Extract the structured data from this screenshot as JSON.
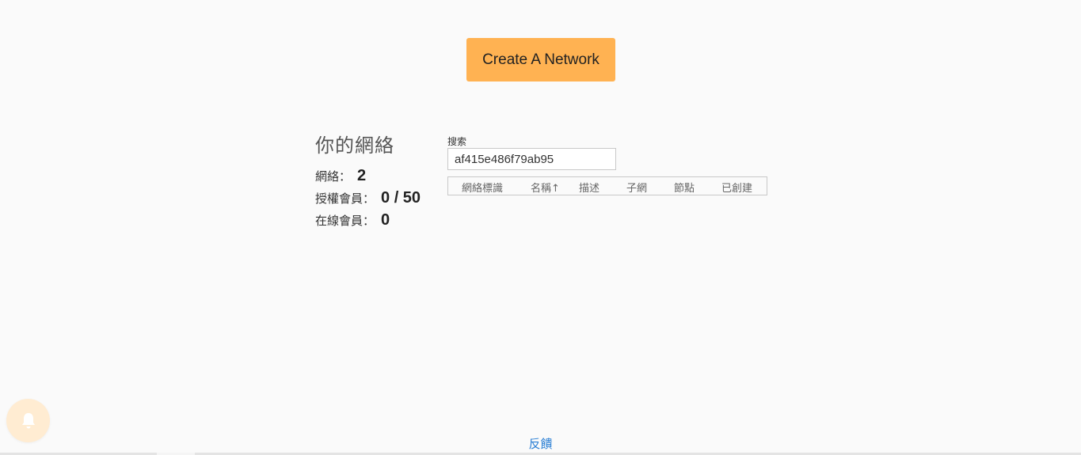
{
  "actions": {
    "create_network_label": "Create A Network"
  },
  "stats": {
    "title": "你的網絡",
    "networks_label": "網絡：",
    "networks_value": "2",
    "authorized_label": "授權會員：",
    "authorized_value": "0 / 50",
    "online_label": "在線會員：",
    "online_value": "0"
  },
  "search": {
    "label": "搜索",
    "value": "af415e486f79ab95"
  },
  "table": {
    "columns": [
      "網絡標識",
      "名稱↑",
      "描述",
      "子網",
      "節點",
      "已創建"
    ]
  },
  "footer": {
    "feedback_label": "反饋"
  },
  "colors": {
    "create_button": "#ffb252",
    "notify_button": "#ffecd2",
    "link": "#2a7fd4"
  },
  "icons": {
    "notify": "bell-icon"
  }
}
